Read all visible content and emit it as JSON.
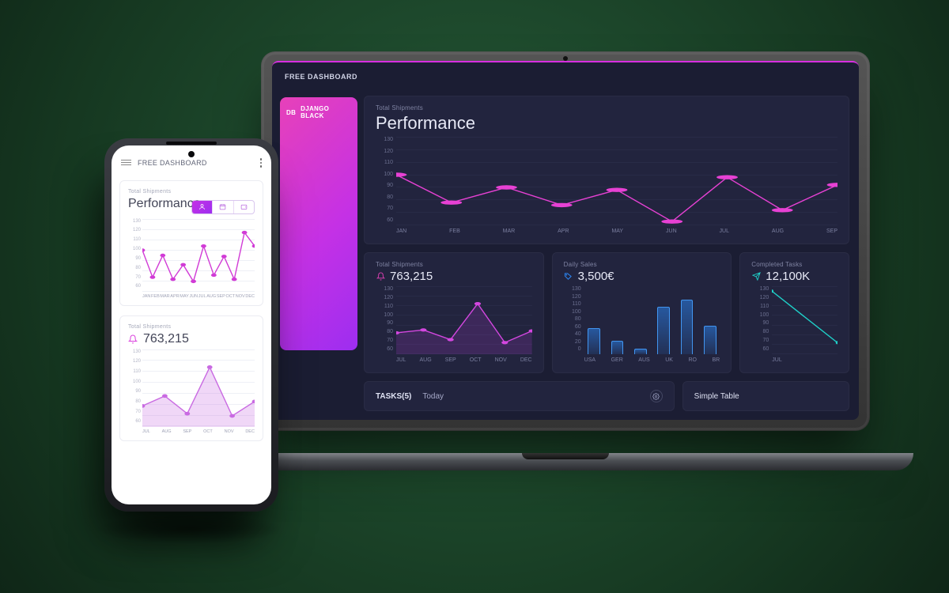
{
  "colors": {
    "accent": "#d72ee0",
    "magenta": "#e741b9",
    "purple": "#9d2ef0",
    "blue": "#2c8cff",
    "cyan": "#1fd1c9",
    "dark_card": "#22243e",
    "dark_bg": "#1b1d33"
  },
  "laptop": {
    "header_title": "FREE DASHBOARD",
    "sidebar": {
      "badge": "DB",
      "label": "DJANGO BLACK"
    },
    "perf": {
      "sub": "Total Shipments",
      "title": "Performance"
    },
    "ship": {
      "sub": "Total Shipments",
      "value": "763,215",
      "icon": "bell-icon"
    },
    "sales": {
      "sub": "Daily Sales",
      "value": "3,500€",
      "icon": "tag-icon"
    },
    "tasks_card": {
      "sub": "Completed Tasks",
      "value": "12,100K",
      "icon": "send-icon"
    },
    "tasks_panel": {
      "label": "TASKS(5)",
      "tab": "Today"
    },
    "table_panel": {
      "label": "Simple Table"
    }
  },
  "phone": {
    "header_title": "FREE DASHBOARD",
    "perf": {
      "sub": "Total Shipments",
      "title": "Performance"
    },
    "seg": {
      "a_icon": "user-icon",
      "b_icon": "calendar-icon",
      "c_icon": "wallet-icon"
    },
    "ship": {
      "sub": "Total Shipments",
      "value": "763,215",
      "icon": "bell-icon"
    }
  },
  "chart_data": [
    {
      "id": "laptop_perf",
      "type": "line",
      "title": "Performance",
      "ylabel": "",
      "xlabel": "",
      "ylim": [
        60,
        130
      ],
      "y_ticks": [
        130,
        120,
        110,
        100,
        90,
        80,
        70,
        60
      ],
      "categories": [
        "JAN",
        "FEB",
        "MAR",
        "APR",
        "MAY",
        "JUN",
        "JUL",
        "AUG",
        "SEP"
      ],
      "values": [
        100,
        78,
        90,
        76,
        88,
        63,
        98,
        72,
        92
      ]
    },
    {
      "id": "laptop_ship",
      "type": "area",
      "title": "Total Shipments",
      "ylim": [
        60,
        130
      ],
      "y_ticks": [
        130,
        120,
        110,
        100,
        90,
        80,
        70,
        60
      ],
      "categories": [
        "JUL",
        "AUG",
        "SEP",
        "OCT",
        "NOV",
        "DEC"
      ],
      "values": [
        82,
        85,
        75,
        112,
        72,
        84
      ]
    },
    {
      "id": "laptop_sales",
      "type": "bar",
      "title": "Daily Sales",
      "ylim": [
        0,
        130
      ],
      "y_ticks": [
        130,
        120,
        110,
        100,
        80,
        60,
        40,
        20,
        0
      ],
      "categories": [
        "USA",
        "GER",
        "AUS",
        "UK",
        "RO",
        "BR"
      ],
      "values": [
        50,
        25,
        10,
        90,
        105,
        55
      ]
    },
    {
      "id": "laptop_tasks",
      "type": "line",
      "title": "Completed Tasks",
      "ylim": [
        60,
        130
      ],
      "y_ticks": [
        130,
        120,
        110,
        100,
        90,
        80,
        70,
        60
      ],
      "categories": [
        "JUL"
      ],
      "values": [
        125,
        72
      ]
    },
    {
      "id": "phone_perf",
      "type": "line",
      "title": "Performance",
      "ylim": [
        60,
        130
      ],
      "y_ticks": [
        130,
        120,
        110,
        100,
        90,
        80,
        70,
        60
      ],
      "categories": [
        "JAN",
        "FEB",
        "MAR",
        "APR",
        "MAY",
        "JUN",
        "JUL",
        "AUG",
        "SEP",
        "OCT",
        "NOV",
        "DEC"
      ],
      "values": [
        100,
        74,
        95,
        72,
        86,
        70,
        104,
        76,
        94,
        72,
        117,
        104
      ]
    },
    {
      "id": "phone_ship",
      "type": "area",
      "title": "Total Shipments",
      "ylim": [
        60,
        130
      ],
      "y_ticks": [
        130,
        120,
        110,
        100,
        90,
        80,
        70,
        60
      ],
      "categories": [
        "JUL",
        "AUG",
        "SEP",
        "OCT",
        "NOV",
        "DEC"
      ],
      "values": [
        79,
        88,
        72,
        114,
        70,
        83
      ]
    }
  ]
}
